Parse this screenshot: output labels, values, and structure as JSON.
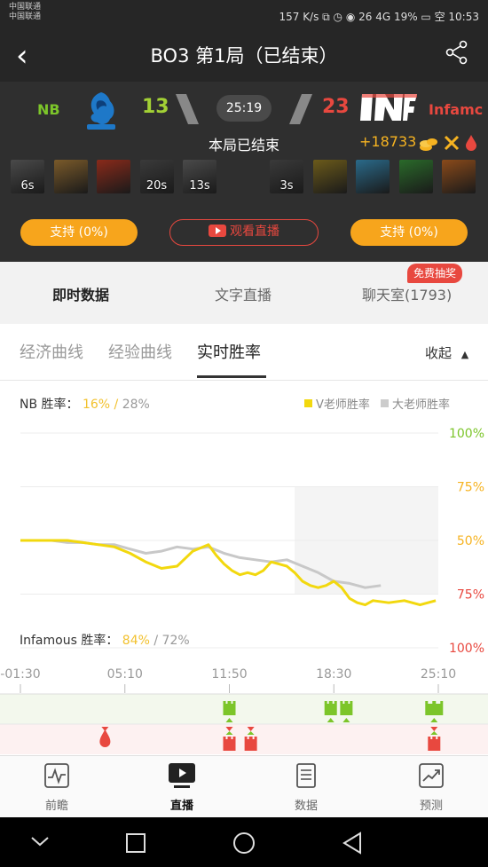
{
  "status_bar": {
    "carrier_1": "中国联通",
    "carrier_2": "中国联通",
    "right": "157 K/s  ⧉  ◷  ◉  26  4G  19%  ▭  空  10:53"
  },
  "header": {
    "title": "BO3  第1局（已结束）"
  },
  "match": {
    "team_left": "NB",
    "team_right": "Infamc",
    "score_left": "13",
    "score_right": "23",
    "time": "25:19",
    "status": "本局已结束",
    "gold_diff": "+18733",
    "heroes_left": [
      {
        "timer": "6s",
        "color": "#4a4a4a"
      },
      {
        "timer": "",
        "color": "#7a5a2a"
      },
      {
        "timer": "",
        "color": "#8a2a1a"
      },
      {
        "timer": "20s",
        "color": "#3a3a3a"
      },
      {
        "timer": "13s",
        "color": "#4a4a4a"
      }
    ],
    "heroes_right": [
      {
        "timer": "3s",
        "color": "#3a3a3a"
      },
      {
        "timer": "",
        "color": "#6b5a1a"
      },
      {
        "timer": "",
        "color": "#2a6a8a"
      },
      {
        "timer": "",
        "color": "#2a6a2a"
      },
      {
        "timer": "",
        "color": "#8a4a1a"
      }
    ],
    "support_left": "支持 (0%)",
    "support_right": "支持 (0%)",
    "watch_live": "观看直播"
  },
  "tabs": {
    "live_data": "即时数据",
    "text_live": "文字直播",
    "chat": "聊天室(1793)",
    "chat_badge": "免费抽奖"
  },
  "subtabs": {
    "economy": "经济曲线",
    "experience": "经验曲线",
    "win_rate": "实时胜率",
    "collapse": "收起"
  },
  "chart_labels": {
    "nb_prefix": "NB 胜率：",
    "nb_v": "16%",
    "nb_sep": " / ",
    "nb_big": "28%",
    "inf_prefix": "Infamous 胜率：",
    "inf_v": "84%",
    "inf_sep": " / ",
    "inf_big": "72%",
    "legend_v": "V老师胜率",
    "legend_big": "大老师胜率"
  },
  "chart_data": {
    "type": "line",
    "x_ticks": [
      "-01:30",
      "05:10",
      "11:50",
      "18:30",
      "25:10"
    ],
    "x_tick_minutes": [
      -1.5,
      5.1667,
      11.8333,
      18.5,
      25.1667
    ],
    "xlim": [
      -1.5,
      25.1667
    ],
    "y_ticks": [
      "100%",
      "75%",
      "50%",
      "75%",
      "100%"
    ],
    "ylim": [
      0,
      100
    ],
    "y_description": "Infamous win probability (%)",
    "colors": {
      "v": "#f2d80e",
      "big": "#c8c8c8",
      "pos_tick": "#7cc52a",
      "neg_tick": "#e8483f"
    },
    "series": [
      {
        "name": "V老师胜率",
        "color": "#f2d80e",
        "x": [
          -1.5,
          -0.5,
          0.5,
          1.5,
          2.5,
          3.5,
          4.5,
          5.5,
          6.5,
          7.5,
          8.5,
          9.5,
          10.5,
          11.0,
          11.5,
          12.0,
          12.5,
          13.0,
          13.5,
          14.0,
          14.5,
          15.0,
          15.5,
          16.0,
          16.5,
          17.0,
          17.5,
          18.0,
          18.5,
          19.0,
          19.5,
          20.0,
          20.5,
          21.0,
          22.0,
          23.0,
          24.0,
          25.0
        ],
        "values": [
          50,
          50,
          50,
          50,
          49,
          48,
          47,
          44,
          40,
          37,
          38,
          45,
          48,
          43,
          39,
          36,
          34,
          35,
          34,
          36,
          40,
          39,
          38,
          35,
          31,
          29,
          28,
          29,
          31,
          28,
          23,
          21,
          20,
          22,
          21,
          22,
          20,
          22
        ]
      },
      {
        "name": "大老师胜率",
        "color": "#c8c8c8",
        "x": [
          -1.5,
          -0.5,
          0.5,
          1.5,
          2.5,
          3.5,
          4.5,
          5.5,
          6.5,
          7.5,
          8.5,
          9.5,
          10.5,
          11.5,
          12.5,
          13.5,
          14.5,
          15.5,
          16.5,
          17.5,
          18.5,
          19.5,
          20.5,
          21.5
        ],
        "values": [
          50,
          50,
          50,
          49,
          49,
          48,
          48,
          46,
          44,
          45,
          47,
          46,
          47,
          44,
          42,
          41,
          40,
          41,
          38,
          35,
          31,
          30,
          28,
          29
        ]
      }
    ],
    "events": [
      {
        "minute": 11.833,
        "side": "top",
        "icon": "tower",
        "color": "#7cc52a"
      },
      {
        "minute": 18.3,
        "side": "top",
        "icon": "tower",
        "color": "#7cc52a"
      },
      {
        "minute": 19.3,
        "side": "top",
        "icon": "tower",
        "color": "#7cc52a"
      },
      {
        "minute": 24.9,
        "side": "top",
        "icon": "barracks",
        "color": "#7cc52a"
      },
      {
        "minute": 3.9,
        "side": "bottom",
        "icon": "blood",
        "color": "#e8483f"
      },
      {
        "minute": 11.833,
        "side": "bottom",
        "icon": "tower",
        "color": "#e8483f"
      },
      {
        "minute": 13.2,
        "side": "bottom",
        "icon": "tower",
        "color": "#e8483f"
      },
      {
        "minute": 24.9,
        "side": "bottom",
        "icon": "tower",
        "color": "#e8483f"
      }
    ]
  },
  "bottom_nav": {
    "preview": "前瞻",
    "live": "直播",
    "data": "数据",
    "predict": "预测"
  }
}
